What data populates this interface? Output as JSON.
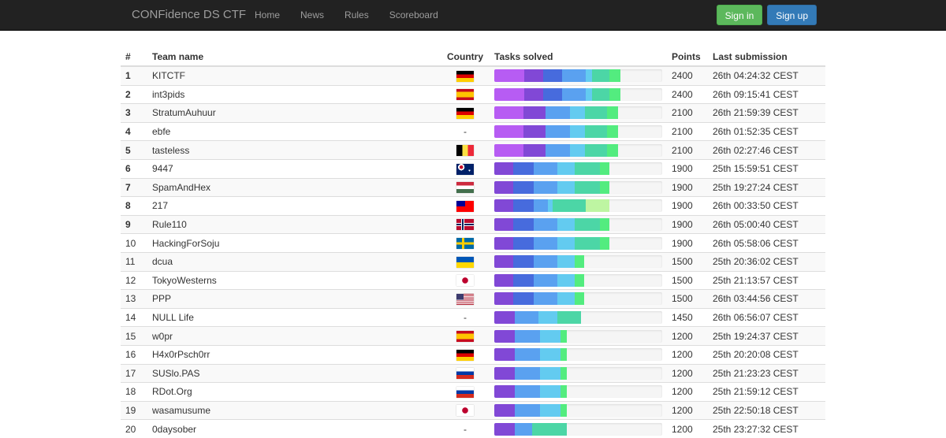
{
  "navbar": {
    "brand": "CONFidence DS CTF",
    "links": [
      "Home",
      "News",
      "Rules",
      "Scoreboard"
    ],
    "signin": "Sign in",
    "signup": "Sign up"
  },
  "table": {
    "headers": [
      "#",
      "Team name",
      "Country",
      "Tasks solved",
      "Points",
      "Last submission"
    ]
  },
  "colors": {
    "violet": "#b75cf3",
    "purple": "#8148d6",
    "blue": "#476bdd",
    "skyblue": "#5aa1f0",
    "cyan": "#63cbf0",
    "teal": "#4cd6a6",
    "green": "#53ec7f",
    "lightgreen": "#bef5a2"
  },
  "rows": [
    {
      "rank": "1",
      "team": "KITCTF",
      "country": "de",
      "points": "2400",
      "last": "26th 04:24:32 CEST",
      "tasks": [
        [
          "violet",
          38
        ],
        [
          "purple",
          24
        ],
        [
          "blue",
          24
        ],
        [
          "skyblue",
          30
        ],
        [
          "cyan",
          8
        ],
        [
          "teal",
          22
        ],
        [
          "green",
          14
        ]
      ]
    },
    {
      "rank": "2",
      "team": "int3pids",
      "country": "es",
      "points": "2400",
      "last": "26th 09:15:41 CEST",
      "tasks": [
        [
          "violet",
          38
        ],
        [
          "purple",
          24
        ],
        [
          "blue",
          24
        ],
        [
          "skyblue",
          30
        ],
        [
          "cyan",
          8
        ],
        [
          "teal",
          22
        ],
        [
          "green",
          14
        ]
      ]
    },
    {
      "rank": "3",
      "team": "StratumAuhuur",
      "country": "de",
      "points": "2100",
      "last": "26th 21:59:39 CEST",
      "tasks": [
        [
          "violet",
          37
        ],
        [
          "purple",
          28
        ],
        [
          "skyblue",
          31
        ],
        [
          "cyan",
          19
        ],
        [
          "teal",
          28
        ],
        [
          "green",
          14
        ]
      ]
    },
    {
      "rank": "4",
      "team": "ebfe",
      "country": "",
      "points": "2100",
      "last": "26th 01:52:35 CEST",
      "tasks": [
        [
          "violet",
          37
        ],
        [
          "purple",
          28
        ],
        [
          "skyblue",
          31
        ],
        [
          "cyan",
          19
        ],
        [
          "teal",
          28
        ],
        [
          "green",
          14
        ]
      ]
    },
    {
      "rank": "5",
      "team": "tasteless",
      "country": "be",
      "points": "2100",
      "last": "26th 02:27:46 CEST",
      "tasks": [
        [
          "violet",
          37
        ],
        [
          "purple",
          28
        ],
        [
          "skyblue",
          31
        ],
        [
          "cyan",
          19
        ],
        [
          "teal",
          28
        ],
        [
          "green",
          14
        ]
      ]
    },
    {
      "rank": "6",
      "team": "9447",
      "country": "au",
      "points": "1900",
      "last": "25th 15:59:51 CEST",
      "tasks": [
        [
          "purple",
          24
        ],
        [
          "blue",
          26
        ],
        [
          "skyblue",
          30
        ],
        [
          "cyan",
          22
        ],
        [
          "teal",
          32
        ],
        [
          "green",
          12
        ]
      ]
    },
    {
      "rank": "7",
      "team": "SpamAndHex",
      "country": "hu",
      "points": "1900",
      "last": "25th 19:27:24 CEST",
      "tasks": [
        [
          "purple",
          24
        ],
        [
          "blue",
          26
        ],
        [
          "skyblue",
          30
        ],
        [
          "cyan",
          22
        ],
        [
          "teal",
          32
        ],
        [
          "green",
          12
        ]
      ]
    },
    {
      "rank": "8",
      "team": "217",
      "country": "tw",
      "points": "1900",
      "last": "26th 00:33:50 CEST",
      "tasks": [
        [
          "purple",
          24
        ],
        [
          "blue",
          26
        ],
        [
          "skyblue",
          18
        ],
        [
          "cyan",
          6
        ],
        [
          "teal",
          42
        ],
        [
          "lightgreen",
          30
        ]
      ]
    },
    {
      "rank": "9",
      "team": "Rule110",
      "country": "no",
      "points": "1900",
      "last": "26th 05:00:40 CEST",
      "tasks": [
        [
          "purple",
          24
        ],
        [
          "blue",
          26
        ],
        [
          "skyblue",
          30
        ],
        [
          "cyan",
          22
        ],
        [
          "teal",
          32
        ],
        [
          "green",
          12
        ]
      ]
    },
    {
      "rank": "10",
      "team": "HackingForSoju",
      "country": "se",
      "points": "1900",
      "last": "26th 05:58:06 CEST",
      "tasks": [
        [
          "purple",
          24
        ],
        [
          "blue",
          26
        ],
        [
          "skyblue",
          30
        ],
        [
          "cyan",
          22
        ],
        [
          "teal",
          32
        ],
        [
          "green",
          12
        ]
      ]
    },
    {
      "rank": "11",
      "team": "dcua",
      "country": "ua",
      "points": "1500",
      "last": "25th 20:36:02 CEST",
      "tasks": [
        [
          "purple",
          24
        ],
        [
          "blue",
          26
        ],
        [
          "skyblue",
          30
        ],
        [
          "cyan",
          22
        ],
        [
          "green",
          12
        ]
      ]
    },
    {
      "rank": "12",
      "team": "TokyoWesterns",
      "country": "jp",
      "points": "1500",
      "last": "25th 21:13:57 CEST",
      "tasks": [
        [
          "purple",
          24
        ],
        [
          "blue",
          26
        ],
        [
          "skyblue",
          30
        ],
        [
          "cyan",
          22
        ],
        [
          "green",
          12
        ]
      ]
    },
    {
      "rank": "13",
      "team": "PPP",
      "country": "us",
      "points": "1500",
      "last": "26th 03:44:56 CEST",
      "tasks": [
        [
          "purple",
          24
        ],
        [
          "blue",
          26
        ],
        [
          "skyblue",
          30
        ],
        [
          "cyan",
          22
        ],
        [
          "green",
          12
        ]
      ]
    },
    {
      "rank": "14",
      "team": "NULL Life",
      "country": "",
      "points": "1450",
      "last": "26th 06:56:07 CEST",
      "tasks": [
        [
          "purple",
          26
        ],
        [
          "skyblue",
          30
        ],
        [
          "cyan",
          24
        ],
        [
          "teal",
          30
        ]
      ]
    },
    {
      "rank": "15",
      "team": "w0pr",
      "country": "es",
      "points": "1200",
      "last": "25th 19:24:37 CEST",
      "tasks": [
        [
          "purple",
          26
        ],
        [
          "skyblue",
          32
        ],
        [
          "cyan",
          26
        ],
        [
          "green",
          8
        ]
      ]
    },
    {
      "rank": "16",
      "team": "H4x0rPsch0rr",
      "country": "de",
      "points": "1200",
      "last": "25th 20:20:08 CEST",
      "tasks": [
        [
          "purple",
          26
        ],
        [
          "skyblue",
          32
        ],
        [
          "cyan",
          26
        ],
        [
          "green",
          8
        ]
      ]
    },
    {
      "rank": "17",
      "team": "SUSlo.PAS",
      "country": "ru",
      "points": "1200",
      "last": "25th 21:23:23 CEST",
      "tasks": [
        [
          "purple",
          26
        ],
        [
          "skyblue",
          32
        ],
        [
          "cyan",
          26
        ],
        [
          "green",
          8
        ]
      ]
    },
    {
      "rank": "18",
      "team": "RDot.Org",
      "country": "ru",
      "points": "1200",
      "last": "25th 21:59:12 CEST",
      "tasks": [
        [
          "purple",
          26
        ],
        [
          "skyblue",
          32
        ],
        [
          "cyan",
          26
        ],
        [
          "green",
          8
        ]
      ]
    },
    {
      "rank": "19",
      "team": "wasamusume",
      "country": "jp",
      "points": "1200",
      "last": "25th 22:50:18 CEST",
      "tasks": [
        [
          "purple",
          26
        ],
        [
          "skyblue",
          32
        ],
        [
          "cyan",
          26
        ],
        [
          "green",
          8
        ]
      ]
    },
    {
      "rank": "20",
      "team": "0daysober",
      "country": "",
      "points": "1200",
      "last": "25th 23:27:32 CEST",
      "tasks": [
        [
          "purple",
          26
        ],
        [
          "skyblue",
          22
        ],
        [
          "teal",
          44
        ]
      ]
    }
  ],
  "no_country": "-"
}
